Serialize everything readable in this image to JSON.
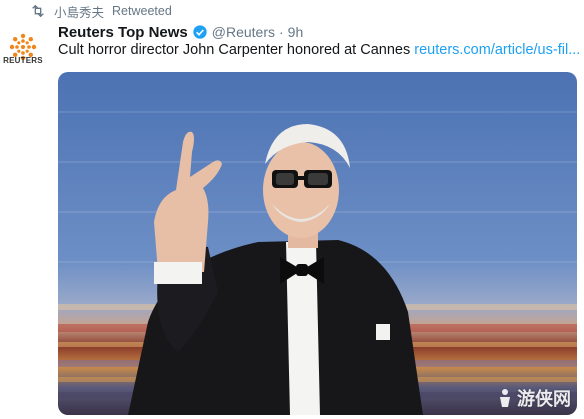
{
  "retweet": {
    "user": "小島秀夫",
    "label": "Retweeted",
    "icon": "retweet-icon"
  },
  "author": {
    "display_name": "Reuters Top News",
    "verified_icon": "verified-badge-icon",
    "handle": "@Reuters",
    "separator": "·",
    "time": "9h",
    "avatar_label": "REUTERS"
  },
  "tweet": {
    "text": "Cult horror director John Carpenter honored at Cannes",
    "link": "reuters.com/article/us-fil..."
  },
  "watermark": {
    "text": "游侠网"
  },
  "colors": {
    "link": "#1da1f2",
    "muted": "#657786",
    "reuters_orange": "#f08519"
  }
}
